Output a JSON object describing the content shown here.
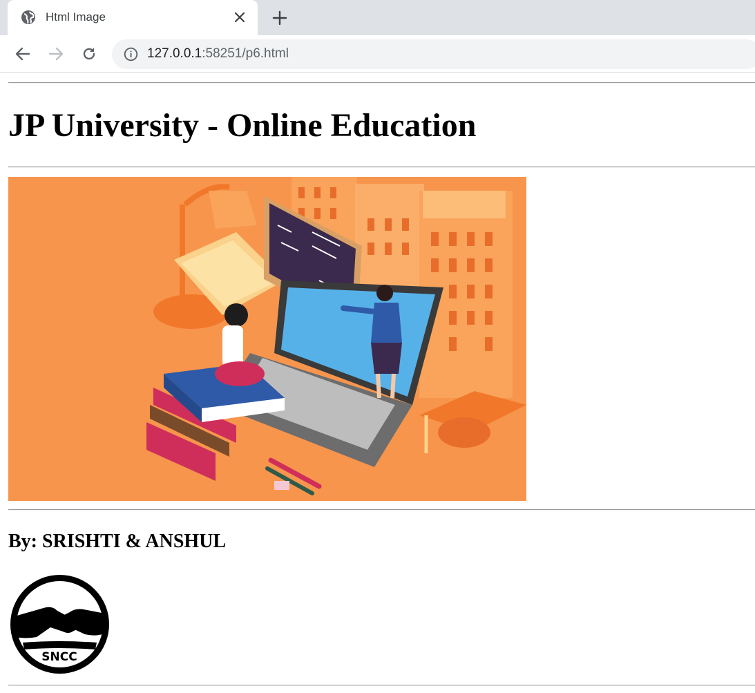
{
  "browser": {
    "tab": {
      "title": "Html Image",
      "favicon": "globe-icon"
    },
    "toolbar": {
      "back": "arrow-left-icon",
      "forward": "arrow-right-icon",
      "reload": "reload-icon"
    },
    "address": {
      "host": "127.0.0.1",
      "rest": ":58251/p6.html",
      "security": "info-icon"
    }
  },
  "page": {
    "heading": "JP University - Online Education",
    "image": {
      "alt": "Online education illustration"
    },
    "byline": "By: SRISHTI & ANSHUL",
    "logo": {
      "text": "SNCC"
    }
  },
  "colors": {
    "hero_bg": "#f7954d",
    "accent_orange": "#f1782a",
    "building": "#f9a35b",
    "screen": "#56b1e8"
  }
}
